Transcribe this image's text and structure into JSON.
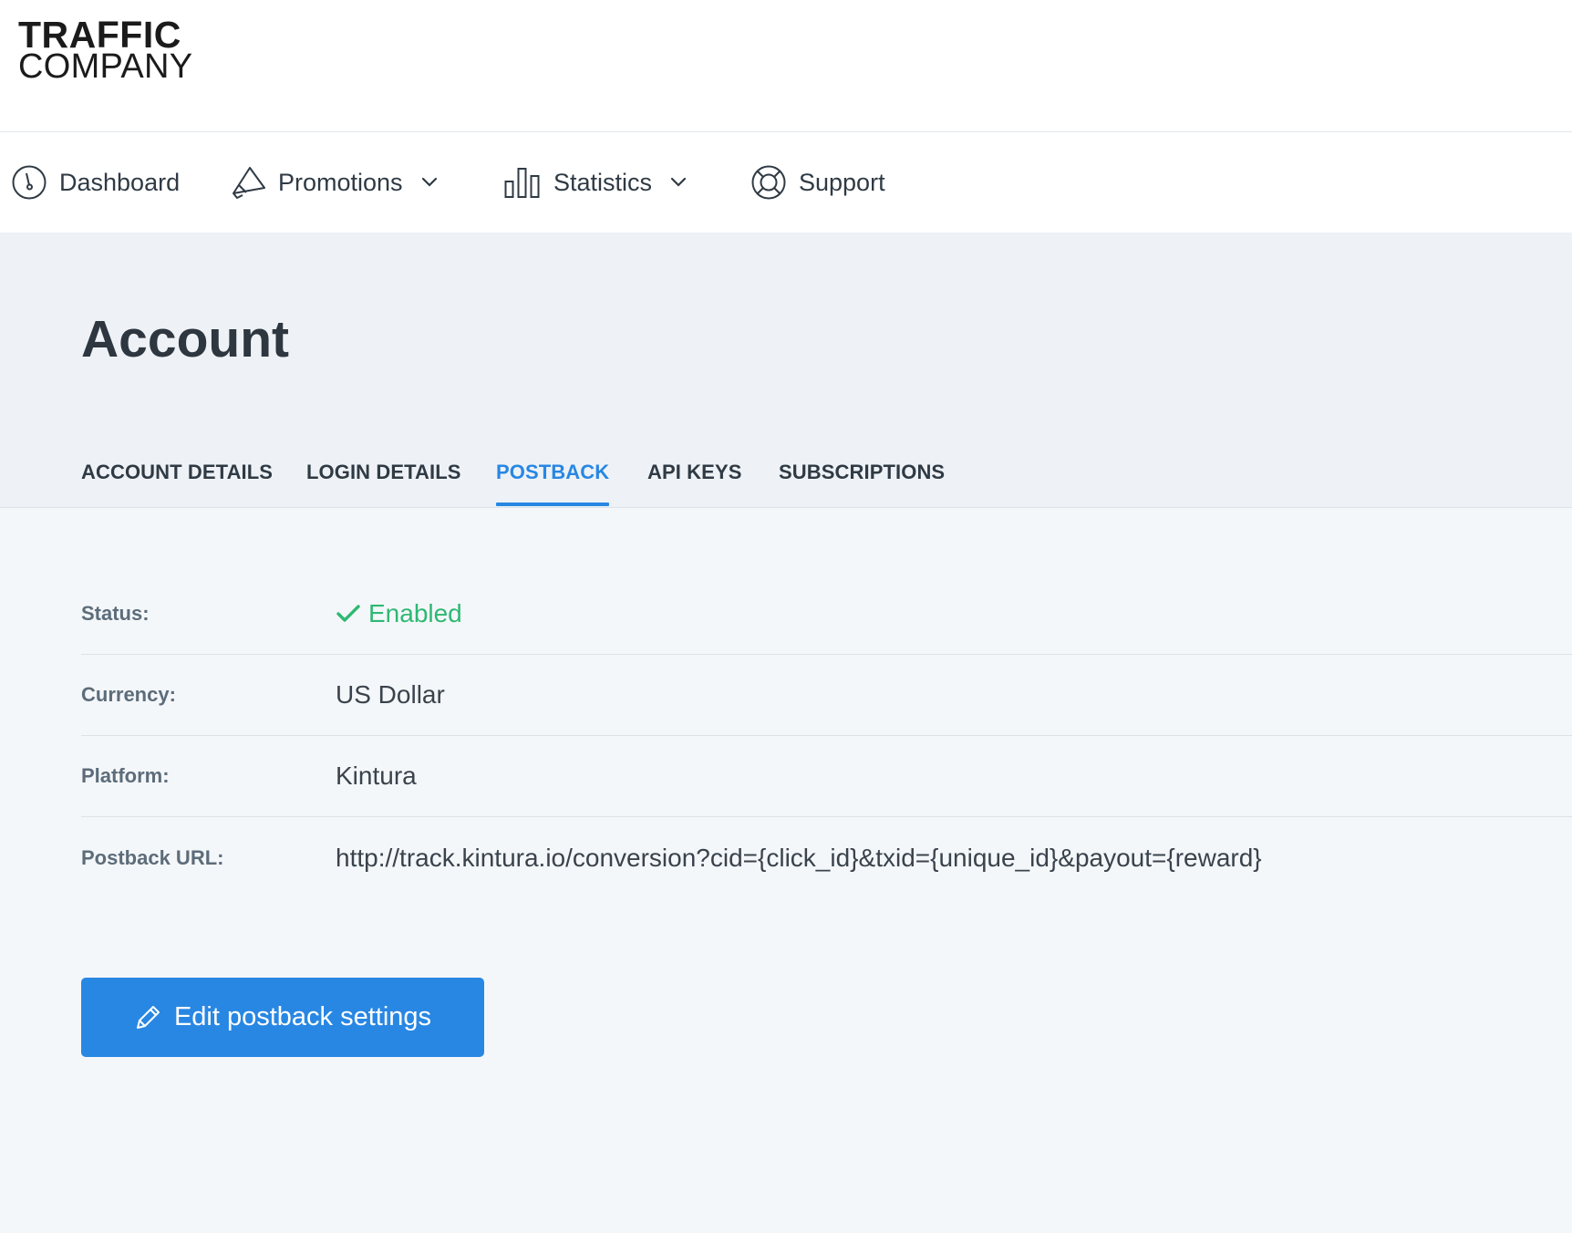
{
  "brand": {
    "line1": "TRAFFIC",
    "line2": "COMPANY"
  },
  "nav": {
    "dashboard": "Dashboard",
    "promotions": "Promotions",
    "statistics": "Statistics",
    "support": "Support"
  },
  "page": {
    "title": "Account"
  },
  "tabs": [
    {
      "label": "ACCOUNT DETAILS"
    },
    {
      "label": "LOGIN DETAILS"
    },
    {
      "label": "POSTBACK",
      "active": true
    },
    {
      "label": "API KEYS"
    },
    {
      "label": "SUBSCRIPTIONS"
    }
  ],
  "postback": {
    "status_label": "Status:",
    "status_value": "Enabled",
    "currency_label": "Currency:",
    "currency_value": "US Dollar",
    "platform_label": "Platform:",
    "platform_value": "Kintura",
    "url_label": "Postback URL:",
    "url_value": "http://track.kintura.io/conversion?cid={click_id}&txid={unique_id}&payout={reward}"
  },
  "actions": {
    "edit_label": "Edit postback settings"
  },
  "colors": {
    "accent": "#2887e3",
    "success": "#2fb873",
    "text_dark": "#2e3740",
    "label_gray": "#5d6c7a"
  },
  "icons": {
    "dashboard": "gauge-icon",
    "promotions": "megaphone-icon",
    "statistics": "bar-chart-icon",
    "support": "lifebuoy-icon",
    "chevron": "chevron-down-icon",
    "status": "checkmark-icon",
    "edit": "pencil-icon"
  }
}
